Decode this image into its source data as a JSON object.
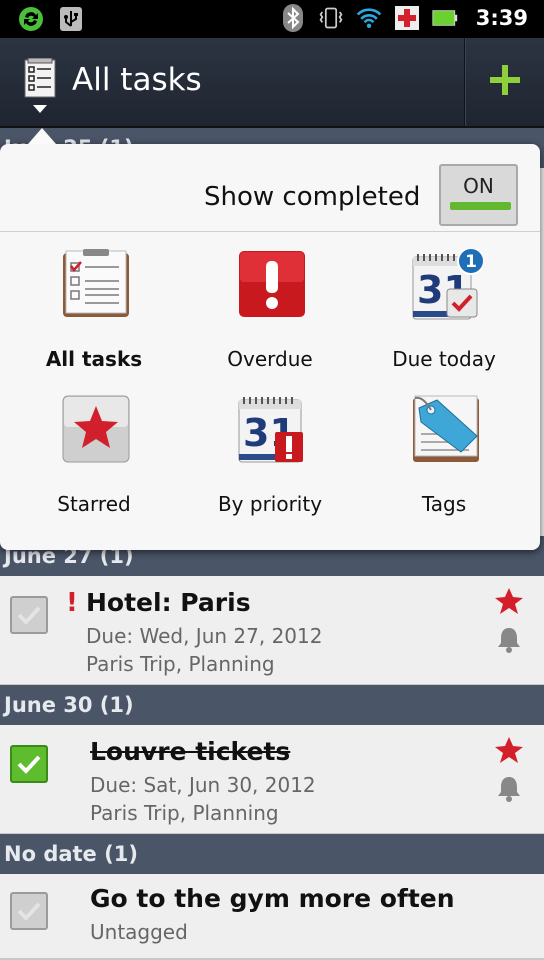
{
  "status_bar": {
    "time": "3:39",
    "icons": [
      "sync-icon",
      "usb-icon",
      "bluetooth-icon",
      "vibrate-icon",
      "wifi-icon",
      "battery-alert-icon",
      "battery-icon"
    ]
  },
  "action_bar": {
    "title": "All tasks",
    "add_icon": "plus-icon"
  },
  "popup": {
    "show_completed_label": "Show completed",
    "toggle_label": "ON",
    "filters": [
      {
        "label": "All tasks",
        "icon": "clipboard-checklist-icon",
        "selected": true
      },
      {
        "label": "Overdue",
        "icon": "exclamation-icon",
        "selected": false
      },
      {
        "label": "Due today",
        "icon": "calendar-check-icon",
        "badge": "1",
        "selected": false
      },
      {
        "label": "Starred",
        "icon": "star-icon",
        "selected": false
      },
      {
        "label": "By priority",
        "icon": "calendar-priority-icon",
        "selected": false
      },
      {
        "label": "Tags",
        "icon": "tag-icon",
        "selected": false
      }
    ],
    "calendar_number": "31"
  },
  "sections": [
    {
      "header": "June 25 (1)"
    },
    {
      "header": "June 27 (1)"
    },
    {
      "header": "June 30 (1)"
    },
    {
      "header": "No date (1)"
    }
  ],
  "tasks": [
    {
      "title": "Hotel: Paris",
      "priority_mark": "!",
      "due": "Due: Wed, Jun 27, 2012",
      "tags": "Paris Trip, Planning",
      "completed": false,
      "starred": true
    },
    {
      "title": "Louvre tickets",
      "due": "Due: Sat, Jun 30, 2012",
      "tags": "Paris Trip, Planning",
      "completed": true,
      "starred": true
    },
    {
      "title": "Go to the gym more often",
      "tags": "Untagged",
      "completed": false,
      "starred": false
    }
  ],
  "colors": {
    "accent_green": "#5ebd2e",
    "priority_red": "#d21f2c",
    "section_header_bg": "#4a5568"
  }
}
